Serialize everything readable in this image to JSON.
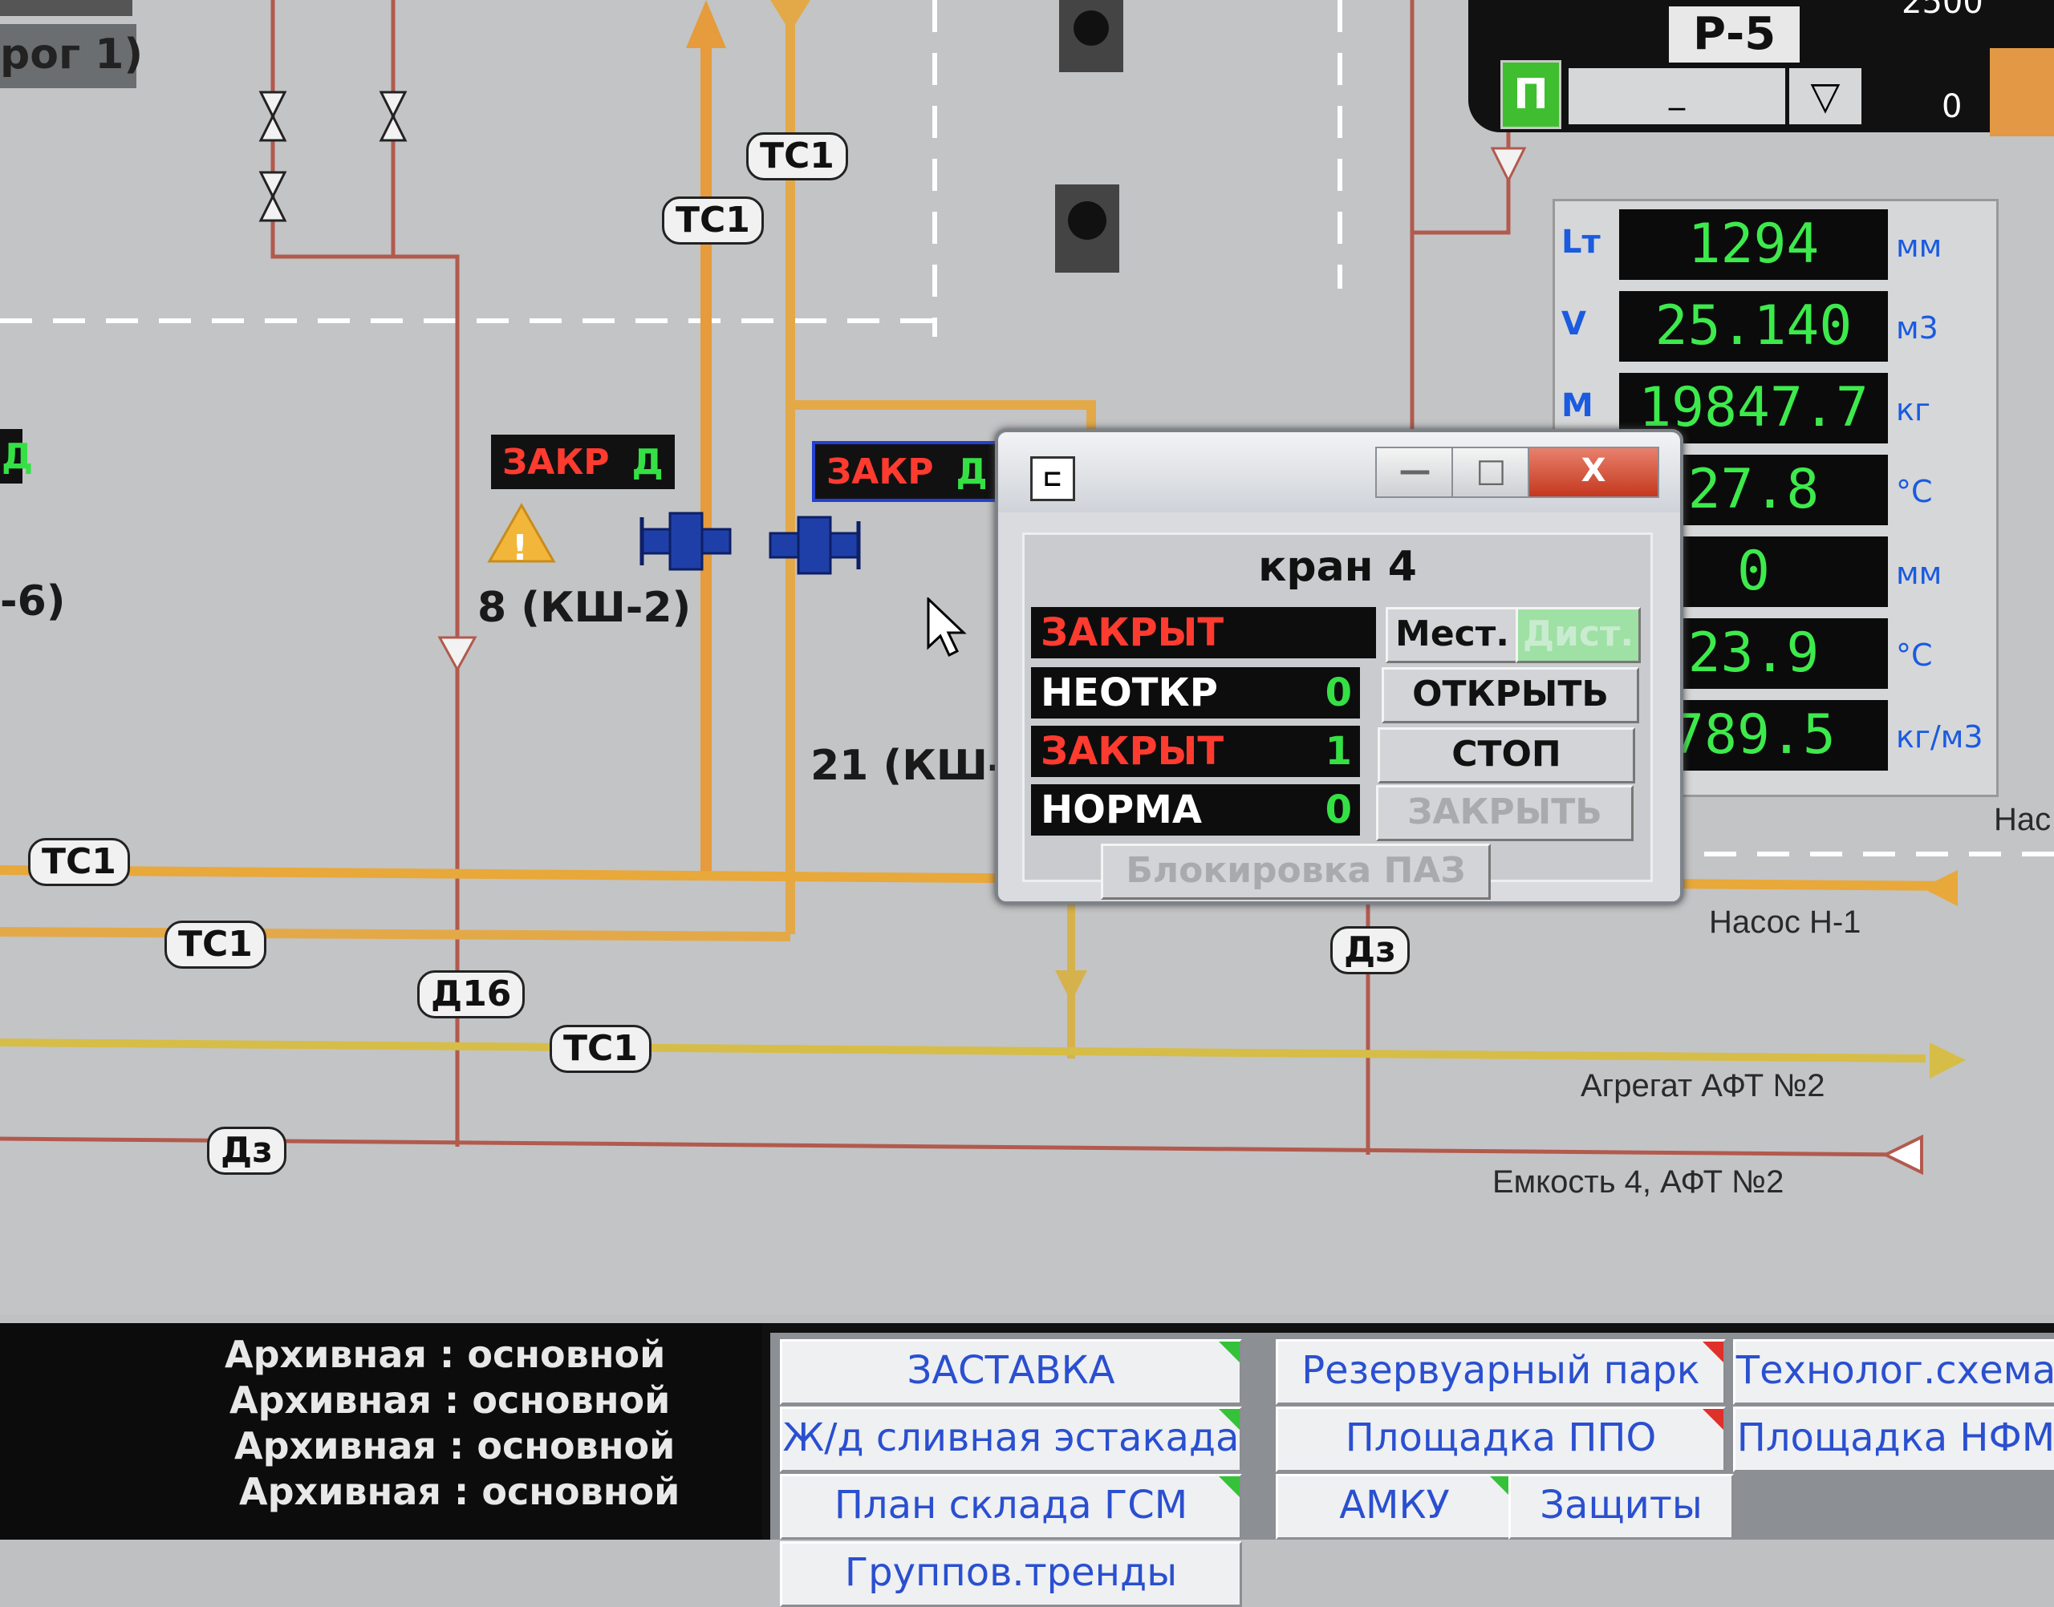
{
  "diagram": {
    "partial_left_label_top": "рог 1)",
    "partial_left_label_mid": "-6)",
    "partial_left_badge": "Д",
    "tags": {
      "ts1": "ТС1",
      "d16": "Д16",
      "dz": "Дз"
    },
    "valve_8": "8 (КШ-2)",
    "valve_21": "21 (КШ-",
    "badge_left": {
      "state": "ЗАКР",
      "mode": "Д"
    },
    "badge_right": {
      "state": "ЗАКР",
      "mode": "Д"
    },
    "pipes": {
      "pump": "Насос Н-1",
      "aggregate": "Агрегат АФТ №2",
      "tank": "Емкость 4, АФТ №2",
      "cut_right": "Нас"
    }
  },
  "tank": {
    "name": "Р-5",
    "mode_button": "П",
    "field_value": "_",
    "dropdown": "▽",
    "scale_top": "2500",
    "scale_bottom": "0",
    "rows": [
      {
        "symbol": "Lт",
        "value": "1294",
        "unit": "мм"
      },
      {
        "symbol": "V",
        "value": "25.140",
        "unit": "м3"
      },
      {
        "symbol": "M",
        "value": "19847.7",
        "unit": "кг"
      },
      {
        "symbol": "",
        "value": "27.8",
        "unit": "°С"
      },
      {
        "symbol": "",
        "value": "0",
        "unit": "мм"
      },
      {
        "symbol": "",
        "value": "23.9",
        "unit": "°С"
      },
      {
        "symbol": "",
        "value": "789.5",
        "unit": "кг/м3"
      }
    ]
  },
  "dialog": {
    "icon": "⊏",
    "minimize": "—",
    "maximize": "□",
    "close": "X",
    "title": "кран 4",
    "status": {
      "text": "ЗАКРЫТ"
    },
    "signals": [
      {
        "label": "НЕОТКР",
        "value": "0",
        "color": "#ffffff"
      },
      {
        "label": "ЗАКРЫТ",
        "value": "1",
        "color": "#ff3b30"
      },
      {
        "label": "НОРМА",
        "value": "0",
        "color": "#ffffff"
      }
    ],
    "buttons": {
      "local": "Мест.",
      "remote": "Дист.",
      "open": "ОТКРЫТЬ",
      "stop": "СТОП",
      "close": "ЗАКРЫТЬ",
      "block": "Блокировка ПАЗ"
    }
  },
  "archive": [
    {
      "label": "Архивная",
      "value": "основной"
    },
    {
      "label": "Архивная",
      "value": "основной"
    },
    {
      "label": "Архивная",
      "value": "основной"
    },
    {
      "label": "Архивная",
      "value": "основной"
    }
  ],
  "nav": [
    {
      "label": "ЗАСТАВКА",
      "flag": "green"
    },
    {
      "label": "Резервуарный парк",
      "flag": "red"
    },
    {
      "label": "Технолог.схема",
      "flag": "none"
    },
    {
      "label": "Ж/д сливная эстакада",
      "flag": "green"
    },
    {
      "label": "Площадка ППО",
      "flag": "red"
    },
    {
      "label": "Площадка НФМ",
      "flag": "none"
    },
    {
      "label": "План склада ГСМ",
      "flag": "green"
    },
    {
      "label": "АМКУ",
      "flag": "green"
    },
    {
      "label": "Защиты",
      "flag": "none"
    },
    {
      "label": "Группов.тренды",
      "flag": "none"
    }
  ]
}
